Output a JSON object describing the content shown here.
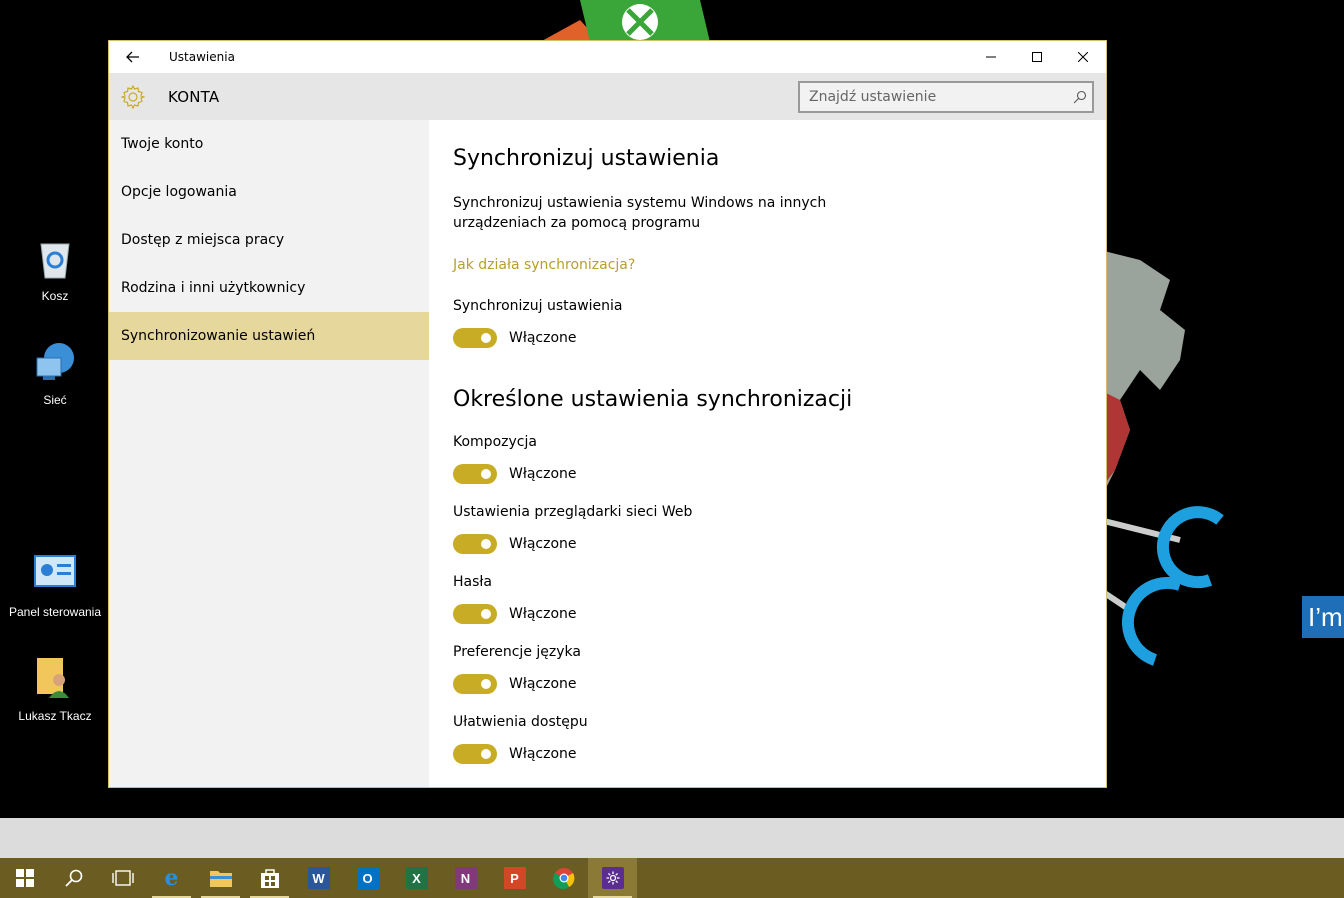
{
  "desktop": {
    "icons": [
      {
        "label": "Kosz"
      },
      {
        "label": "Sieć"
      },
      {
        "label": "Panel sterowania"
      },
      {
        "label": "Lukasz Tkacz"
      }
    ],
    "banner_text": "I’m"
  },
  "window": {
    "title": "Ustawienia",
    "section": "KONTA",
    "search": {
      "placeholder": "Znajdź ustawienie"
    }
  },
  "sidebar": {
    "items": [
      {
        "label": "Twoje konto"
      },
      {
        "label": "Opcje logowania"
      },
      {
        "label": "Dostęp z miejsca pracy"
      },
      {
        "label": "Rodzina i inni użytkownicy"
      },
      {
        "label": "Synchronizowanie ustawień",
        "active": true
      }
    ]
  },
  "content": {
    "heading": "Synchronizuj ustawienia",
    "description": "Synchronizuj ustawienia systemu Windows na innych urządzeniach za pomocą programu",
    "link": "Jak działa synchronizacja?",
    "main_setting": {
      "label": "Synchronizuj ustawienia",
      "state": "Włączone",
      "on": true
    },
    "heading2": "Określone ustawienia synchronizacji",
    "settings": [
      {
        "label": "Kompozycja",
        "state": "Włączone",
        "on": true
      },
      {
        "label": "Ustawienia przeglądarki sieci Web",
        "state": "Włączone",
        "on": true
      },
      {
        "label": "Hasła",
        "state": "Włączone",
        "on": true
      },
      {
        "label": "Preferencje języka",
        "state": "Włączone",
        "on": true
      },
      {
        "label": "Ułatwienia dostępu",
        "state": "Włączone",
        "on": true
      }
    ]
  },
  "colors": {
    "accent": "#c8ac25",
    "accent_light": "#e6d79c",
    "taskbar": "#6b5d22",
    "link": "#b6a02b"
  },
  "taskbar": {
    "items": [
      "start-icon",
      "search-icon",
      "task-view-icon",
      "edge-icon",
      "file-explorer-icon",
      "store-icon",
      "word-icon",
      "outlook-icon",
      "excel-icon",
      "onenote-icon",
      "powerpoint-icon",
      "chrome-icon",
      "settings-icon"
    ]
  }
}
